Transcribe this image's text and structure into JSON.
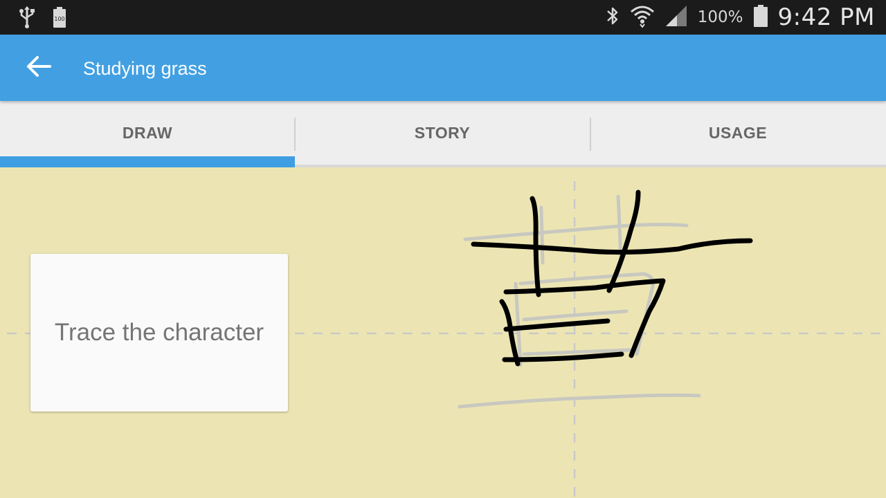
{
  "status_bar": {
    "battery_percent": "100%",
    "time": "9:42 PM",
    "battery_badge": "100",
    "icons": [
      "usb-icon",
      "battery-saver-icon",
      "bluetooth-icon",
      "wifi-icon",
      "signal-icon",
      "battery-icon"
    ]
  },
  "app_bar": {
    "title": "Studying grass",
    "back_icon": "arrow-back-icon",
    "color": "#42a0e2"
  },
  "tabs": [
    {
      "label": "DRAW",
      "selected": true
    },
    {
      "label": "STORY",
      "selected": false
    },
    {
      "label": "USAGE",
      "selected": false
    }
  ],
  "tab_indicator_color": "#3f9ee1",
  "canvas": {
    "background": "#ece5b3",
    "prompt": "Trace the character",
    "stroke_color": "#000000",
    "guide_color": "#c7c7c7"
  }
}
